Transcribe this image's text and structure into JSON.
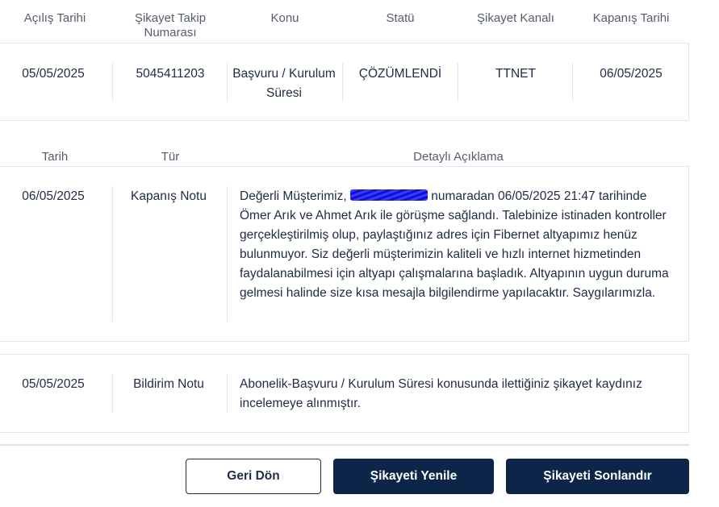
{
  "summary": {
    "headers": [
      "Açılış Tarihi",
      "Şikayet Takip Numarası",
      "Konu",
      "Statü",
      "Şikayet Kanalı",
      "Kapanış Tarihi"
    ],
    "row": {
      "opening_date": "05/05/2025",
      "tracking_number": "5045411203",
      "subject": "Başvuru / Kurulum Süresi",
      "status": "ÇÖZÜMLENDİ",
      "channel": "TTNET",
      "closing_date": "06/05/2025"
    }
  },
  "notes": {
    "headers": [
      "Tarih",
      "Tür",
      "Detaylı Açıklama"
    ],
    "items": [
      {
        "date": "06/05/2025",
        "type": "Kapanış Notu",
        "desc_prefix": "Değerli Müşterimiz, ",
        "desc_rest": " numaradan 06/05/2025 21:47 tarihinde Ömer Arık ve Ahmet Arık ile görüşme sağlandı. Talebinize istinaden kontroller gerçekleştirilmiş olup, paylaştığınız adres için Fibernet altyapımız henüz bulunmuyor. Siz değerli müşterimizin kaliteli ve hızlı internet hizmetinden faydalanabilmesi için altyapı çalışmalarına başladık. Altyapının uygun duruma gelmesi halinde size kısa mesajla bilgilendirme yapılacaktır. Saygılarımızla."
      },
      {
        "date": "05/05/2025",
        "type": "Bildirim Notu",
        "desc": "Abonelik-Başvuru / Kurulum Süresi konusunda ilettiğiniz şikayet kaydınız incelemeye alınmıştır."
      }
    ]
  },
  "actions": {
    "back_label": "Geri Dön",
    "renew_label": "Şikayeti Yenile",
    "close_label": "Şikayeti Sonlandır"
  }
}
